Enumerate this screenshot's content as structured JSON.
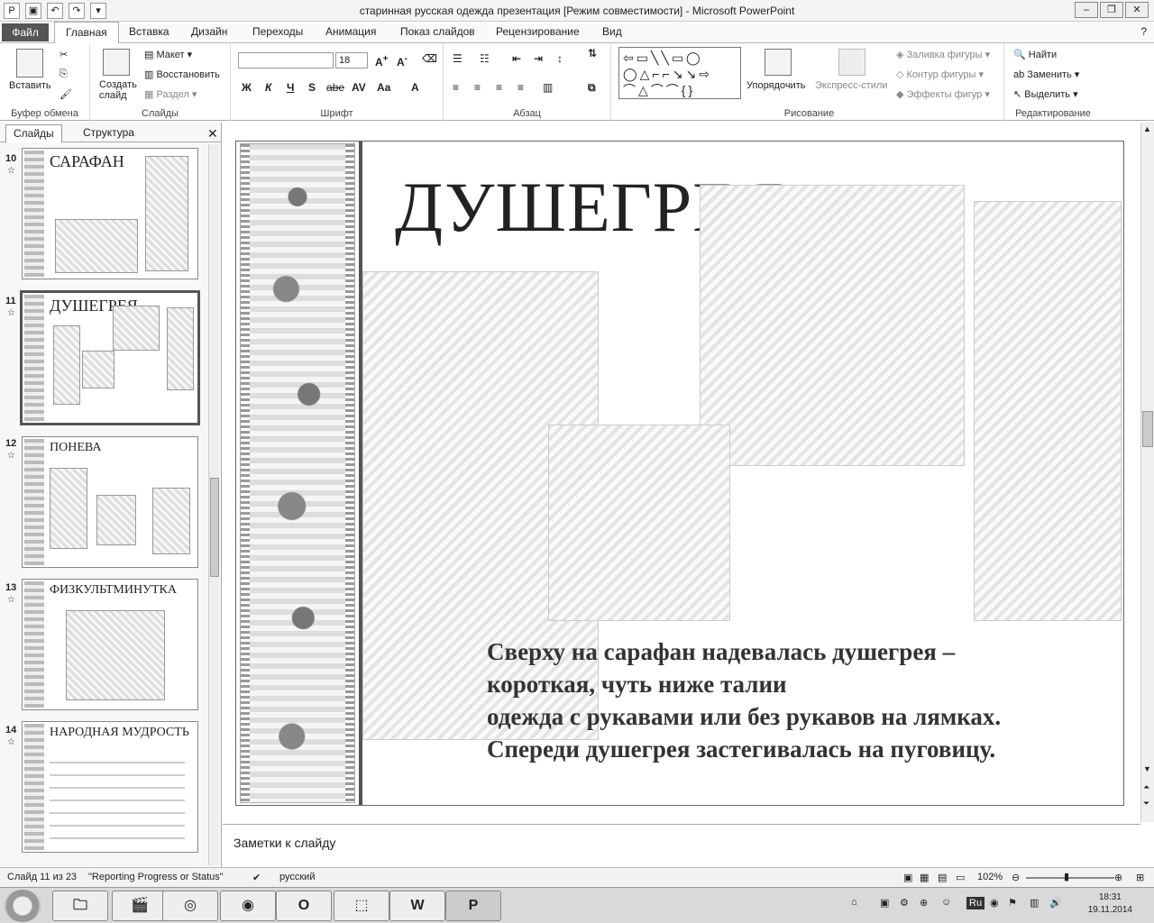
{
  "window": {
    "title": "старинная русская одежда презентация  [Режим совместимости]  -  Microsoft PowerPoint"
  },
  "tabs": [
    "Файл",
    "Главная",
    "Вставка",
    "Дизайн",
    "Переходы",
    "Анимация",
    "Показ слайдов",
    "Рецензирование",
    "Вид"
  ],
  "ribbon": {
    "clipboard": {
      "paste": "Вставить",
      "label": "Буфер обмена"
    },
    "slides": {
      "new_slide": "Создать слайд",
      "layout": "Макет",
      "reset": "Восстановить",
      "section": "Раздел",
      "label": "Слайды"
    },
    "font": {
      "size": "18",
      "label": "Шрифт",
      "bold": "Ж",
      "italic": "К",
      "underline": "Ч",
      "shadow": "S",
      "strike": "abe",
      "spacing": "AV",
      "case": "Aa",
      "color": "A"
    },
    "paragraph": {
      "label": "Абзац"
    },
    "drawing": {
      "arrange": "Упорядочить",
      "quick_styles": "Экспресс-стили",
      "fill": "Заливка фигуры",
      "outline": "Контур фигуры",
      "effects": "Эффекты фигур",
      "label": "Рисование"
    },
    "editing": {
      "find": "Найти",
      "replace": "Заменить",
      "select": "Выделить",
      "label": "Редактирование"
    }
  },
  "left_panel": {
    "tab_slides": "Слайды",
    "tab_outline": "Структура",
    "thumbnails": [
      {
        "number": "10",
        "title": "САРАФАН"
      },
      {
        "number": "11",
        "title": "ДУШЕГРЕЯ"
      },
      {
        "number": "12",
        "title": "ПОНЕВА"
      },
      {
        "number": "13",
        "title": "ФИЗКУЛЬТМИНУТКА"
      },
      {
        "number": "14",
        "title": "НАРОДНАЯ МУДРОСТЬ"
      }
    ]
  },
  "slide": {
    "title": "ДУШЕГРЕЯ",
    "text_lines": [
      "Сверху на сарафан надевалась душегрея –",
      "короткая, чуть ниже талии",
      "одежда с рукавами или без рукавов на лямках.",
      " Спереди душегрея застегивалась на пуговицу."
    ]
  },
  "notes_placeholder": "Заметки к слайду",
  "status": {
    "slide_position": "Слайд 11 из 23",
    "theme": "\"Reporting Progress or Status\"",
    "language": "русский",
    "zoom": "102%"
  },
  "taskbar": {
    "tray_lang": "Ru",
    "time": "18:31",
    "date": "19.11.2014"
  }
}
